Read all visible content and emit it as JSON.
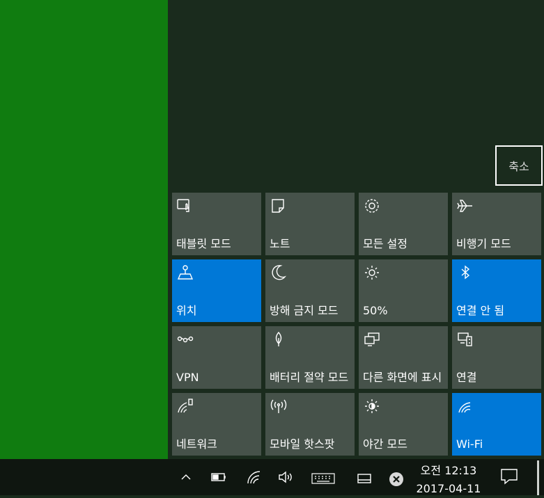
{
  "action_center": {
    "collapse_label": "축소",
    "tiles": [
      {
        "label": "태블릿 모드",
        "icon": "tablet-mode-icon",
        "active": false
      },
      {
        "label": "노트",
        "icon": "note-icon",
        "active": false
      },
      {
        "label": "모든 설정",
        "icon": "settings-gear-icon",
        "active": false
      },
      {
        "label": "비행기 모드",
        "icon": "airplane-icon",
        "active": false
      },
      {
        "label": "위치",
        "icon": "location-icon",
        "active": true
      },
      {
        "label": "방해 금지 모드",
        "icon": "moon-icon",
        "active": false
      },
      {
        "label": "50%",
        "icon": "brightness-icon",
        "active": false
      },
      {
        "label": "연결 안 됨",
        "icon": "bluetooth-icon",
        "active": true
      },
      {
        "label": "VPN",
        "icon": "vpn-icon",
        "active": false
      },
      {
        "label": "배터리 절약 모드",
        "icon": "battery-saver-icon",
        "active": false
      },
      {
        "label": "다른 화면에 표시",
        "icon": "project-icon",
        "active": false
      },
      {
        "label": "연결",
        "icon": "connect-icon",
        "active": false
      },
      {
        "label": "네트워크",
        "icon": "network-icon",
        "active": false
      },
      {
        "label": "모바일 핫스팟",
        "icon": "hotspot-icon",
        "active": false
      },
      {
        "label": "야간 모드",
        "icon": "night-light-icon",
        "active": false
      },
      {
        "label": "Wi-Fi",
        "icon": "wifi-icon",
        "active": true
      }
    ]
  },
  "taskbar": {
    "time": "오전 12:13",
    "date": "2017-04-11",
    "icons": [
      "chevron-up-icon",
      "battery-icon",
      "network-icon",
      "volume-icon",
      "keyboard-icon",
      "tablet-icon",
      "close-circle-icon",
      "notification-icon"
    ]
  },
  "colors": {
    "desktop": "#107c10",
    "panel": "#1a2b1d",
    "tile": "#46524a",
    "tile_active": "#0078d7",
    "taskbar": "#0f1610"
  }
}
